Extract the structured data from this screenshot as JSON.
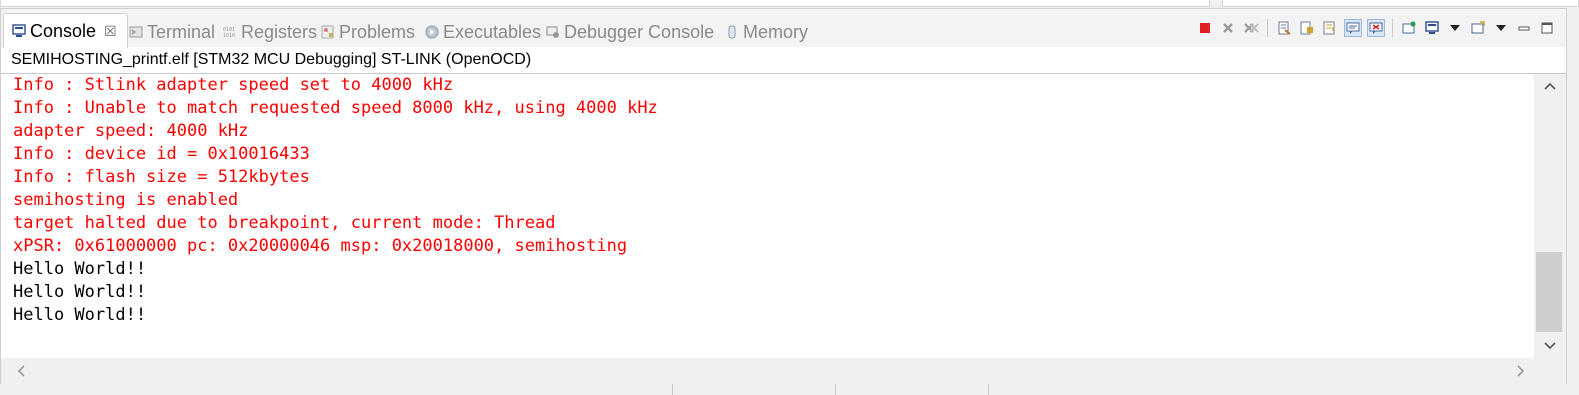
{
  "tabs": [
    {
      "label": "Console",
      "icon": "console-icon",
      "active": true,
      "close": "☒"
    },
    {
      "label": "Terminal",
      "icon": "terminal-icon"
    },
    {
      "label": "Registers",
      "icon": "registers-icon"
    },
    {
      "label": "Problems",
      "icon": "problems-icon"
    },
    {
      "label": "Executables",
      "icon": "executables-icon"
    },
    {
      "label": "Debugger Console",
      "icon": "debugger-console-icon"
    },
    {
      "label": "Memory",
      "icon": "memory-icon"
    }
  ],
  "toolbar_icons": [
    "terminate-icon",
    "remove-launch-icon",
    "remove-all-terminated-icon",
    "clear-console-icon",
    "scroll-lock-icon",
    "word-wrap-icon",
    "show-on-stdout-icon",
    "show-on-stderr-icon",
    "pin-console-icon",
    "display-selected-console-icon",
    "display-console-dropdown-icon",
    "open-console-icon",
    "open-console-dropdown-icon",
    "view-menu-icon",
    "minimize-icon",
    "maximize-icon"
  ],
  "header": {
    "launch_title": "SEMIHOSTING_printf.elf [STM32 MCU Debugging] ST-LINK (OpenOCD)"
  },
  "console_lines": [
    {
      "text": "Info : Stlink adapter speed set to 4000 kHz",
      "stream": "err"
    },
    {
      "text": "Info : Unable to match requested speed 8000 kHz, using 4000 kHz",
      "stream": "err"
    },
    {
      "text": "adapter speed: 4000 kHz",
      "stream": "err"
    },
    {
      "text": "Info : device id = 0x10016433",
      "stream": "err"
    },
    {
      "text": "Info : flash size = 512kbytes",
      "stream": "err"
    },
    {
      "text": "semihosting is enabled",
      "stream": "err"
    },
    {
      "text": "target halted due to breakpoint, current mode: Thread",
      "stream": "err"
    },
    {
      "text": "xPSR: 0x61000000 pc: 0x20000046 msp: 0x20018000, semihosting",
      "stream": "err"
    },
    {
      "text": "Hello World!!",
      "stream": "out"
    },
    {
      "text": "Hello World!!",
      "stream": "out"
    },
    {
      "text": "Hello World!!",
      "stream": "out"
    }
  ],
  "colors": {
    "stderr": "#ff0000",
    "stdout": "#000000",
    "terminate_red": "#e02020"
  },
  "scroll": {
    "vertical_position": 0.63
  }
}
